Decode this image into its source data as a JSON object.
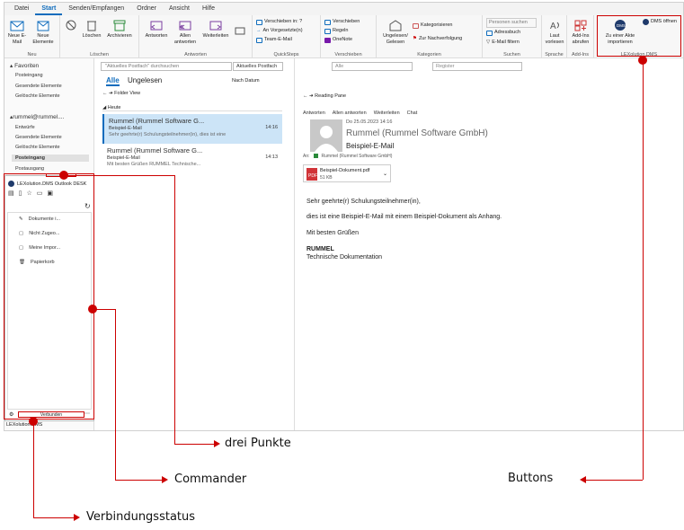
{
  "menu": [
    "Datei",
    "Start",
    "Senden/Empfangen",
    "Ordner",
    "Ansicht",
    "Hilfe"
  ],
  "ribbon": {
    "neue_email": "Neue E-Mail",
    "neue_elemente": "Neue Elemente",
    "group_neu": "Neu",
    "loeschen": "Löschen",
    "archivieren": "Archivieren",
    "group_loeschen": "Löschen",
    "antworten": "Antworten",
    "allen_antworten": "Allen antworten",
    "weiterleiten": "Weiterleiten",
    "group_antworten": "Antworten",
    "qs1": "Verschieben in: ?",
    "qs2": "An Vorgesetzte(n)",
    "qs3": "Team-E-Mail",
    "group_quicksteps": "QuickSteps",
    "verschieben": "Verschieben",
    "regeln": "Regeln",
    "onenote": "OneNote",
    "group_verschieben": "Verschieben",
    "ungelesen": "Ungelesen/ Gelesen",
    "kategorisieren": "Kategorisieren",
    "nachverfolgung": "Zur Nachverfolgung",
    "group_kategorien": "Kategorien",
    "personen": "Personen suchen",
    "adressbuch": "Adressbuch",
    "filter": "E-Mail filtern",
    "group_suchen": "Suchen",
    "laut": "Laut vorlesen",
    "group_sprache": "Sprache",
    "addins": "Add-Ins abrufen",
    "group_addins": "Add-Ins",
    "zu_akte": "Zu einer Akte importieren",
    "dms_oeffnen": "DMS öffnen",
    "group_dms": "LEXolution.DMS"
  },
  "nav": {
    "favoriten": "Favoriten",
    "fav_items": [
      "Posteingang",
      "Gesendete Elemente",
      "Gelöschte Elemente"
    ],
    "account": "rummel@rummel....",
    "acc_items": [
      "Entwürfe",
      "Gesendete Elemente",
      "Gelöschte Elemente",
      "Posteingang",
      "Postausgang"
    ]
  },
  "list": {
    "search_placeholder": "\"Aktuelles Postfach\" durchsuchen",
    "scope": "Aktuelles Postfach",
    "tab_all": "Alle",
    "tab_unread": "Ungelesen",
    "sort": "Nach Datum",
    "folder_view": "Folder View",
    "group_today": "Heute",
    "mails": [
      {
        "from": "Rummel (Rummel Software G...",
        "subject": "Beispiel-E-Mail",
        "preview": "Sehr geehrte(r) Schulungsteilnehmer(in),  dies ist eine",
        "time": "14:16"
      },
      {
        "from": "Rummel (Rummel Software G...",
        "subject": "Beispiel-E-Mail",
        "preview": "Mit besten Grüßen  RUMMEL  Technische...",
        "time": "14:13"
      }
    ]
  },
  "reading": {
    "filter_placeholder": "Alle",
    "search2": "Register",
    "pane_label": "Reading Pane",
    "actions": [
      "Antworten",
      "Allen antworten",
      "Weiterleiten",
      "Chat"
    ],
    "date": "Do 25.05.2023 14:16",
    "sender": "Rummel (Rummel Software GmbH)",
    "subject": "Beispiel-E-Mail",
    "to_label": "An:",
    "to": "Rummel (Rummel Software GmbH)",
    "attachment_name": "Beispiel-Dokument.pdf",
    "attachment_size": "51 KB",
    "body_greeting": "Sehr geehrte(r) Schulungsteilnehmer(in),",
    "body_line": "dies ist eine Beispiel-E-Mail mit einem Beispiel-Dokument als Anhang.",
    "body_closing": "Mit besten Grüßen",
    "body_company": "RUMMEL",
    "body_dept": "Technische Dokumentation"
  },
  "dms": {
    "title": "LEXolution.DMS Outlook DESK",
    "items": [
      "Dokumente i...",
      "Nicht Zugeo...",
      "Meine Impor...",
      "Papierkorb"
    ],
    "status": "Verbunden",
    "footer": "LEXolution.DMS"
  },
  "annotations": {
    "drei_punkte": "drei Punkte",
    "commander": "Commander",
    "buttons": "Buttons",
    "verbindungsstatus": "Verbindungsstatus"
  },
  "colors": {
    "accent": "#0f6cbd",
    "annotation": "#c00000",
    "selected": "#cce4f7"
  }
}
